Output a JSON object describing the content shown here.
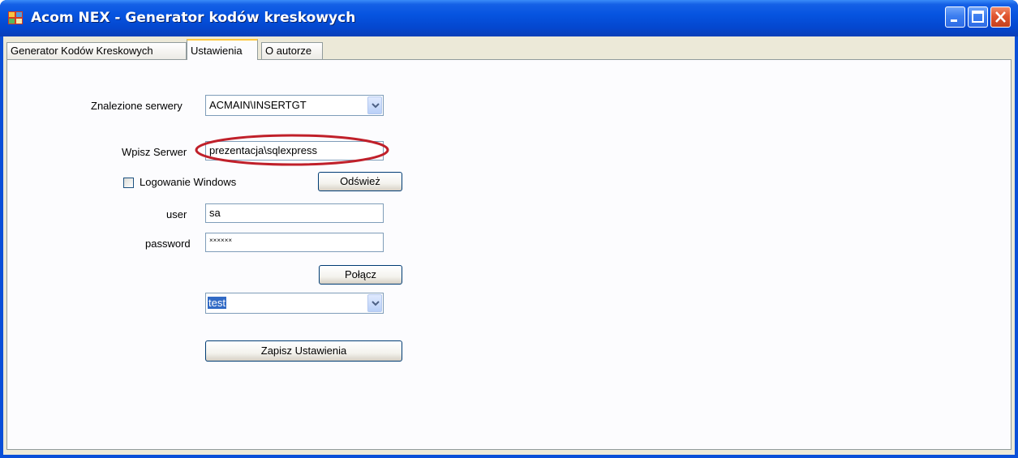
{
  "window": {
    "title": "Acom NEX - Generator kodów kreskowych",
    "icon": "app-icon"
  },
  "tabs": [
    {
      "label": "Generator Kodów Kreskowych",
      "active": false
    },
    {
      "label": "Ustawienia",
      "active": true
    },
    {
      "label": "O autorze",
      "active": false
    }
  ],
  "settings": {
    "found_servers_label": "Znalezione serwery",
    "found_servers_value": "ACMAIN\\INSERTGT",
    "server_label": "Wpisz Serwer",
    "server_value": "prezentacja\\sqlexpress",
    "windows_login_label": "Logowanie Windows",
    "windows_login_checked": false,
    "refresh_label": "Odśwież",
    "user_label": "user",
    "user_value": "sa",
    "password_label": "password",
    "password_value": "××××××",
    "connect_label": "Połącz",
    "database_value": "test",
    "save_label": "Zapisz Ustawienia"
  },
  "colors": {
    "titlebar": "#0654e0",
    "highlight_ellipse": "#c0202a",
    "selection": "#316ac5"
  }
}
